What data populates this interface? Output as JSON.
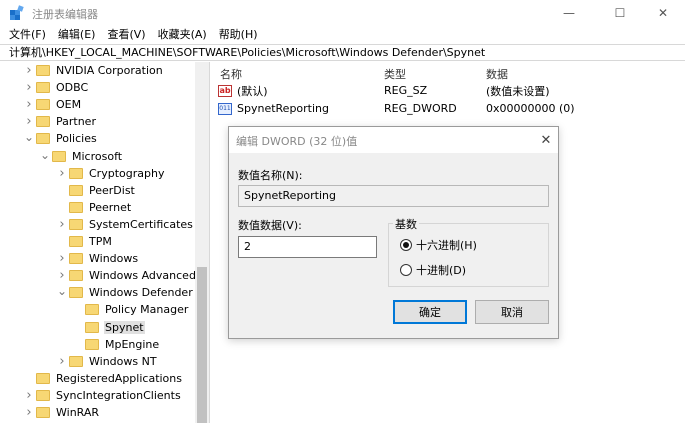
{
  "window": {
    "title": "注册表编辑器",
    "minimize_glyph": "—",
    "maximize_glyph": "☐",
    "close_glyph": "✕"
  },
  "menu": [
    "文件(F)",
    "编辑(E)",
    "查看(V)",
    "收藏夹(A)",
    "帮助(H)"
  ],
  "address": "计算机\\HKEY_LOCAL_MACHINE\\SOFTWARE\\Policies\\Microsoft\\Windows Defender\\Spynet",
  "tree": [
    {
      "label": "NVIDIA Corporation",
      "level": 1,
      "expander": "collapsed"
    },
    {
      "label": "ODBC",
      "level": 1,
      "expander": "collapsed"
    },
    {
      "label": "OEM",
      "level": 1,
      "expander": "collapsed"
    },
    {
      "label": "Partner",
      "level": 1,
      "expander": "collapsed"
    },
    {
      "label": "Policies",
      "level": 1,
      "expander": "expanded"
    },
    {
      "label": "Microsoft",
      "level": 2,
      "expander": "expanded"
    },
    {
      "label": "Cryptography",
      "level": 3,
      "expander": "collapsed"
    },
    {
      "label": "PeerDist",
      "level": 3,
      "expander": "none"
    },
    {
      "label": "Peernet",
      "level": 3,
      "expander": "none"
    },
    {
      "label": "SystemCertificates",
      "level": 3,
      "expander": "collapsed"
    },
    {
      "label": "TPM",
      "level": 3,
      "expander": "none"
    },
    {
      "label": "Windows",
      "level": 3,
      "expander": "collapsed"
    },
    {
      "label": "Windows Advanced Th",
      "level": 3,
      "expander": "collapsed"
    },
    {
      "label": "Windows Defender",
      "level": 3,
      "expander": "expanded"
    },
    {
      "label": "Policy Manager",
      "level": 4,
      "expander": "none"
    },
    {
      "label": "Spynet",
      "level": 4,
      "expander": "none",
      "selected": true
    },
    {
      "label": "MpEngine",
      "level": 4,
      "expander": "none"
    },
    {
      "label": "Windows NT",
      "level": 3,
      "expander": "collapsed"
    },
    {
      "label": "RegisteredApplications",
      "level": 1,
      "expander": "none"
    },
    {
      "label": "SyncIntegrationClients",
      "level": 1,
      "expander": "collapsed"
    },
    {
      "label": "WinRAR",
      "level": 1,
      "expander": "collapsed"
    }
  ],
  "list": {
    "columns": [
      "名称",
      "类型",
      "数据"
    ],
    "rows": [
      {
        "icon": "string-value-icon",
        "icon_glyph": "ab",
        "name": "(默认)",
        "type": "REG_SZ",
        "data": "(数值未设置)"
      },
      {
        "icon": "binary-value-icon",
        "icon_glyph": "011",
        "name": "SpynetReporting",
        "type": "REG_DWORD",
        "data": "0x00000000 (0)"
      }
    ]
  },
  "dialog": {
    "title": "编辑 DWORD (32 位)值",
    "close_glyph": "✕",
    "name_label": "数值名称(N):",
    "name_value": "SpynetReporting",
    "data_label": "数值数据(V):",
    "data_value": "2",
    "base_label": "基数",
    "radio_hex": "十六进制(H)",
    "radio_dec": "十进制(D)",
    "selected_base": "hex",
    "ok_label": "确定",
    "cancel_label": "取消"
  },
  "colors": {
    "folder": "#f7d774",
    "accent": "#0078d7",
    "selection": "#e0e0e0"
  }
}
